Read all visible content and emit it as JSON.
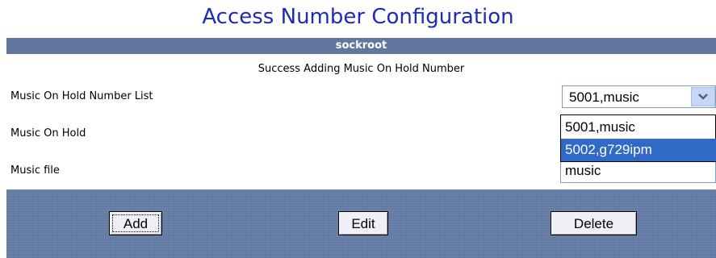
{
  "page": {
    "title": "Access Number Configuration",
    "section_header": "sockroot",
    "status_message": "Success Adding Music On Hold Number"
  },
  "form": {
    "number_list_label": "Music On Hold Number List",
    "music_on_hold_label": "Music On Hold",
    "music_file_label": "Music file",
    "number_list_selected": "5001,music",
    "dropdown_options": [
      "5001,music",
      "5002,g729ipm"
    ],
    "dropdown_highlighted_index": 1,
    "music_file_value": "music"
  },
  "actions": {
    "add_label": "Add",
    "edit_label": "Edit",
    "delete_label": "Delete"
  },
  "icons": {
    "dropdown_arrow": "chevron-down-icon"
  },
  "colors": {
    "title": "#1f2bb4",
    "header_bar": "#6277a0",
    "button_bar": "#6179a3",
    "option_highlight": "#3169c6"
  }
}
